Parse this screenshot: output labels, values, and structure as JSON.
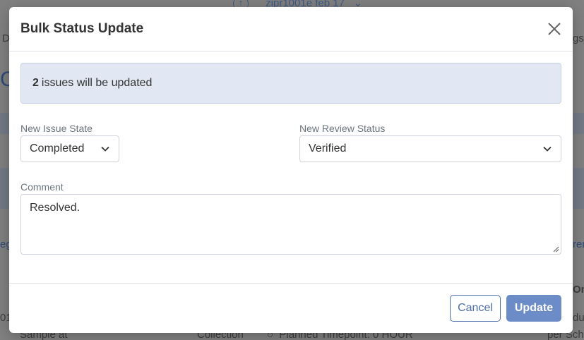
{
  "background": {
    "top_nav_text": "zipr1001e feb 17",
    "row_text_1": "Sample at",
    "row_text_2": "Collection",
    "row_text_3": "Planned Timepoint: 0 HOUR",
    "row_text_4": "per Sch",
    "fragments": [
      "D",
      "gs",
      "eg",
      "ren",
      "01",
      "du",
      "On"
    ]
  },
  "modal": {
    "title": "Bulk Status Update",
    "alert": {
      "count": "2",
      "message": "issues will be updated"
    },
    "issue_state": {
      "label": "New Issue State",
      "value": "Completed"
    },
    "review_status": {
      "label": "New Review Status",
      "value": "Verified"
    },
    "comment": {
      "label": "Comment",
      "value": "Resolved."
    },
    "buttons": {
      "cancel": "Cancel",
      "update": "Update"
    }
  },
  "colors": {
    "primary": "#4f6fa8",
    "update_button": "#6c8cc8",
    "alert_bg": "#e2e8f3"
  }
}
